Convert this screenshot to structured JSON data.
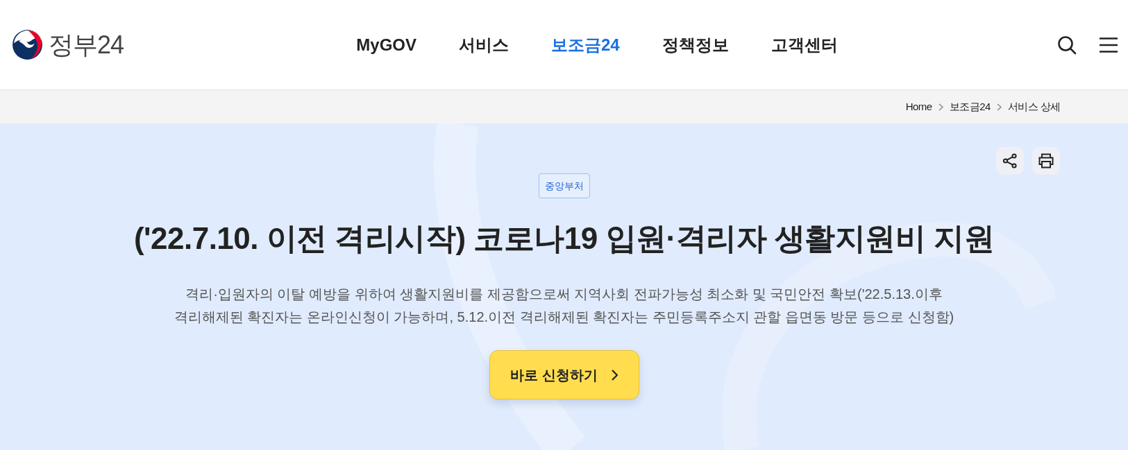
{
  "header": {
    "logo": {
      "text": "정부24"
    },
    "nav": [
      {
        "label": "MyGOV",
        "selected": false
      },
      {
        "label": "서비스",
        "selected": false
      },
      {
        "label": "보조금24",
        "selected": true
      },
      {
        "label": "정책정보",
        "selected": false
      },
      {
        "label": "고객센터",
        "selected": false
      }
    ]
  },
  "breadcrumb": [
    "Home",
    "보조금24",
    "서비스 상세"
  ],
  "hero": {
    "badge": "중앙부처",
    "title": "('22.7.10. 이전 격리시작) 코로나19 입원·격리자 생활지원비 지원",
    "description": "격리·입원자의 이탈 예방을 위하여 생활지원비를 제공함으로써 지역사회 전파가능성 최소화 및 국민안전 확보('22.5.13.이후 격리해제된 확진자는 온라인신청이 가능하며, 5.12.이전 격리해제된 확진자는 주민등록주소지 관할 읍면동 방문 등으로 신청함)",
    "apply_button": "바로 신청하기"
  }
}
